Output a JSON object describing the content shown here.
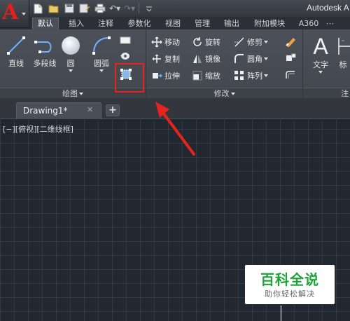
{
  "window": {
    "title": "Autodesk A"
  },
  "ribbon_tabs": [
    {
      "label": "默认",
      "active": true
    },
    {
      "label": "插入"
    },
    {
      "label": "注释"
    },
    {
      "label": "参数化"
    },
    {
      "label": "视图"
    },
    {
      "label": "管理"
    },
    {
      "label": "输出"
    },
    {
      "label": "附加模块"
    },
    {
      "label": "A360"
    }
  ],
  "draw_panel": {
    "title": "绘图",
    "buttons": {
      "line": "直线",
      "polyline": "多段线",
      "circle": "圆",
      "arc": "圆弧"
    }
  },
  "modify_panel": {
    "title": "修改",
    "buttons": {
      "move": "移动",
      "rotate": "旋转",
      "trim": "修剪",
      "copy": "复制",
      "mirror": "镜像",
      "fillet": "圆角",
      "stretch": "拉伸",
      "scale": "缩放",
      "array": "阵列"
    }
  },
  "annotation_panel": {
    "text": "文字",
    "dimension_partial": "标",
    "title_partial": "注"
  },
  "file_tabs": [
    {
      "label": "Drawing1*"
    }
  ],
  "viewport": {
    "label": "[−][俯视][二维线框]"
  },
  "watermark": {
    "title": "百科全说",
    "subtitle": "助你轻松解决"
  },
  "colors": {
    "highlight": "#e8231f",
    "arrow": "#e8231f",
    "background": "#212830",
    "watermark_green": "#1fa23a"
  }
}
